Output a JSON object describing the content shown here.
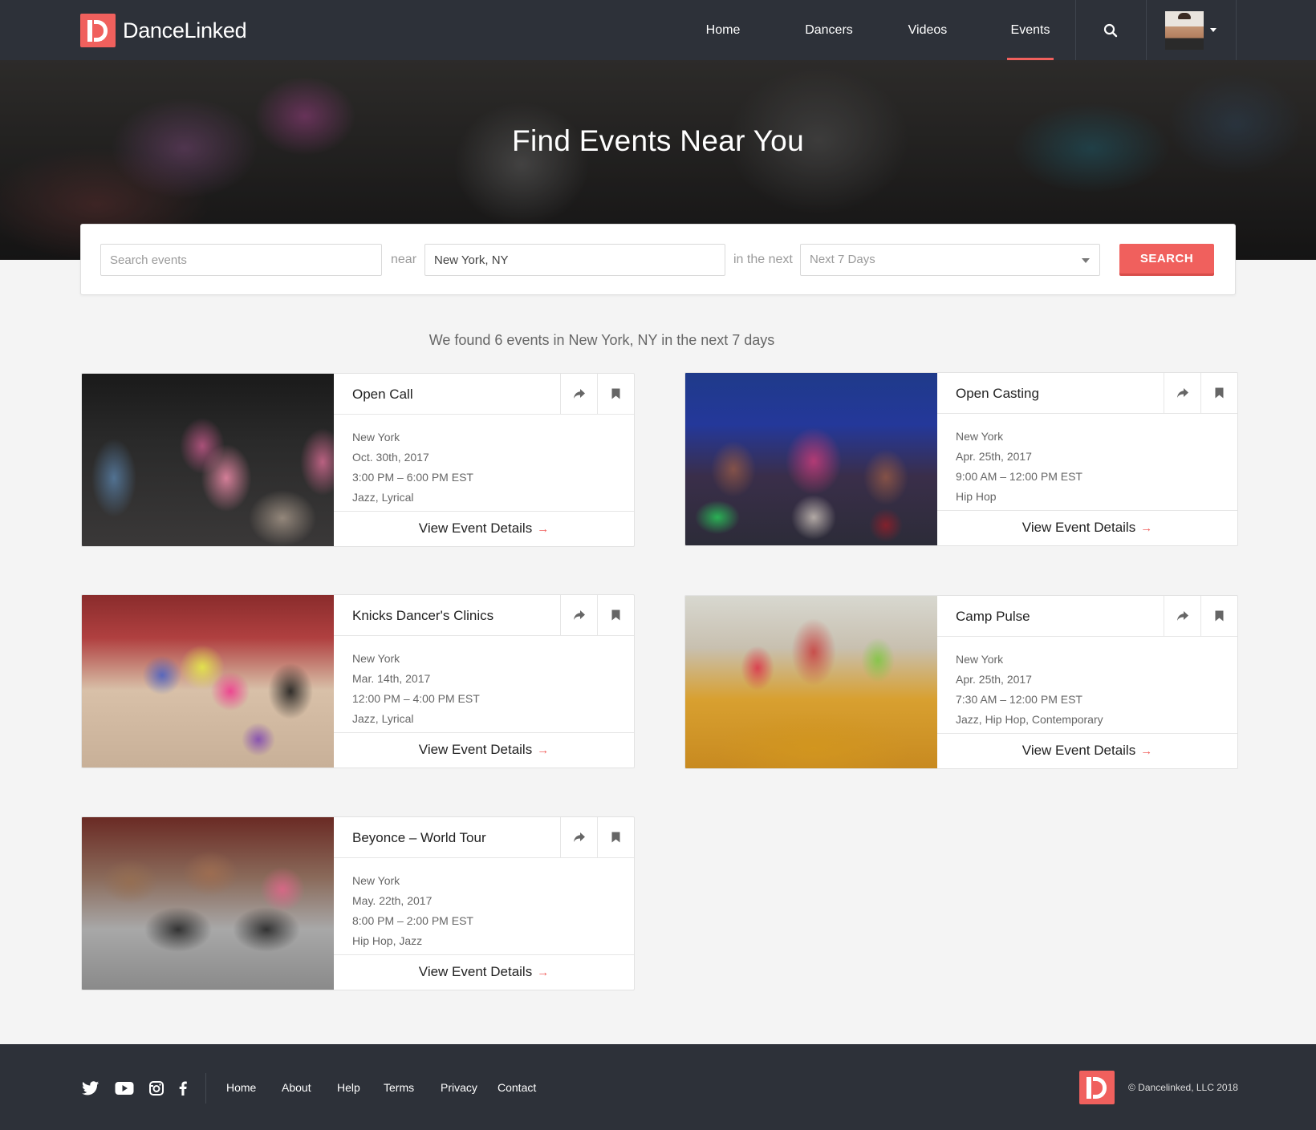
{
  "brand": {
    "name": "DanceLinked"
  },
  "nav": {
    "items": [
      {
        "label": "Home"
      },
      {
        "label": "Dancers"
      },
      {
        "label": "Videos"
      },
      {
        "label": "Events"
      }
    ],
    "active": "Events"
  },
  "hero": {
    "title": "Find Events Near You"
  },
  "search": {
    "keyword_placeholder": "Search events",
    "near_label": "near",
    "location_value": "New York, NY",
    "within_label": "in the next",
    "range_value": "Next 7 Days",
    "button_label": "SEARCH"
  },
  "results_text": "We found 6 events in New York, NY in the next 7 days",
  "events": [
    {
      "title": "Open Call",
      "city": "New York",
      "date": "Oct. 30th, 2017",
      "time": "3:00 PM – 6:00 PM EST",
      "styles": "Jazz, Lyrical",
      "link": "View Event Details"
    },
    {
      "title": "Open Casting",
      "city": "New York",
      "date": "Apr. 25th, 2017",
      "time": "9:00 AM – 12:00 PM EST",
      "styles": "Hip Hop",
      "link": "View Event Details"
    },
    {
      "title": "Knicks Dancer's Clinics",
      "city": "New York",
      "date": "Mar. 14th, 2017",
      "time": "12:00 PM – 4:00 PM EST",
      "styles": "Jazz, Lyrical",
      "link": "View Event Details"
    },
    {
      "title": "Camp Pulse",
      "city": "New York",
      "date": "Apr. 25th, 2017",
      "time": "7:30 AM – 12:00 PM EST",
      "styles": "Jazz, Hip Hop, Contemporary",
      "link": "View Event Details"
    },
    {
      "title": "Beyonce – World Tour",
      "city": "New York",
      "date": "May. 22th, 2017",
      "time": "8:00 PM – 2:00 PM EST",
      "styles": "Hip Hop, Jazz",
      "link": "View Event Details"
    }
  ],
  "footer": {
    "social": [
      "twitter-icon",
      "youtube-icon",
      "instagram-icon",
      "facebook-icon"
    ],
    "links": [
      "Home",
      "About",
      "Help",
      "Terms",
      "Privacy",
      "Contact"
    ],
    "copyright": "© Dancelinked, LLC 2018"
  },
  "colors": {
    "accent": "#f0605d",
    "header_bg": "#2d3139",
    "page_bg": "#f4f4f4"
  }
}
